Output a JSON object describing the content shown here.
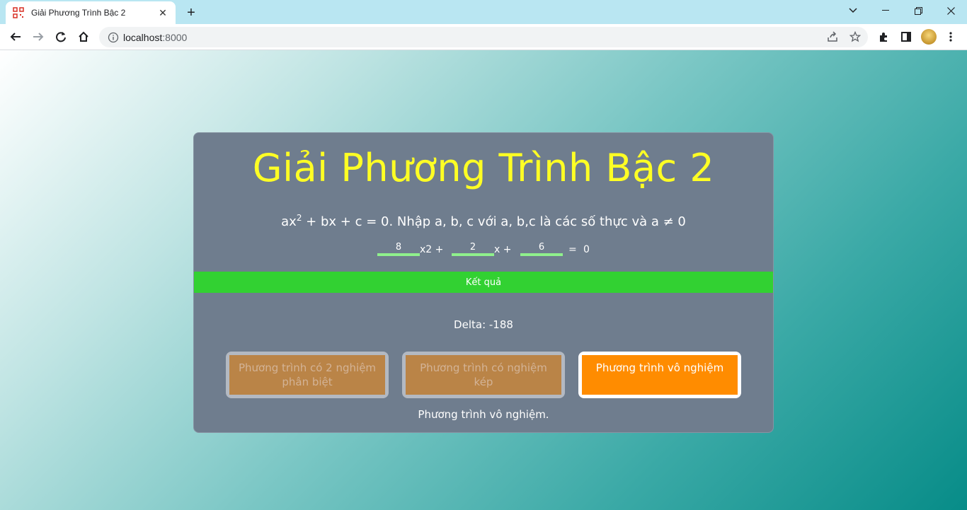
{
  "browser": {
    "tab_title": "Giải Phương Trình Bậc 2",
    "url_host": "localhost",
    "url_port": ":8000"
  },
  "app": {
    "title": "Giải Phương Trình Bậc 2",
    "subtitle_prefix": "ax",
    "subtitle_sup": "2",
    "subtitle_rest": " + bx + c = 0. Nhập a, b, c với a, b,c là các số thực và a ≠ 0",
    "inputs": {
      "a": "8",
      "b": "2",
      "c": "6"
    },
    "x2_label": "x2 +",
    "x_label": "x +",
    "equals_label": "=",
    "zero_label": "0",
    "result_button": "Kết quả",
    "delta_text": "Delta: -188",
    "options": [
      {
        "label": "Phương trình có 2 nghiệm phân biệt",
        "active": false
      },
      {
        "label": "Phương trình có nghiệm kép",
        "active": false
      },
      {
        "label": "Phương trình vô nghiệm",
        "active": true
      }
    ],
    "conclusion": "Phương trình vô nghiệm."
  },
  "colors": {
    "title": "#ffff24",
    "card_bg": "#6f7d8e",
    "result_green": "#32d132",
    "option_inactive": "#ba8447",
    "option_active": "#ff8c00",
    "input_underline": "#8ff08c"
  }
}
